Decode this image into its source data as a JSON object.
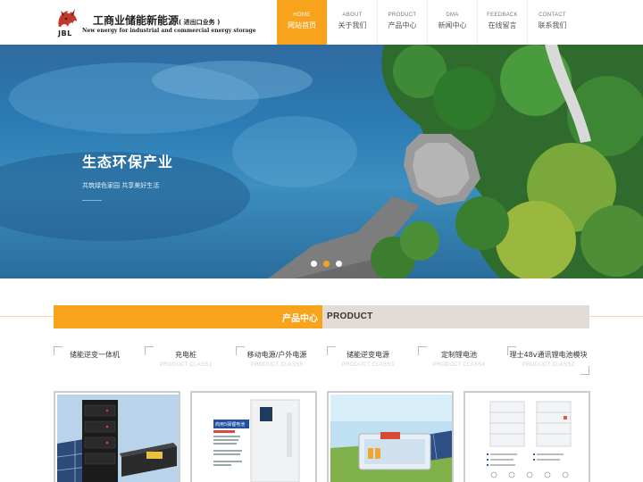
{
  "header": {
    "logo_mark": "JBL",
    "logo_title": "工商业储能新能源",
    "logo_title_note": "( 进出口业务 )",
    "logo_subtitle": "New energy for industrial and commercial energy storage"
  },
  "nav": [
    {
      "en": "HOME",
      "cn": "网站首页",
      "active": true
    },
    {
      "en": "ABOUT",
      "cn": "关于我们",
      "active": false
    },
    {
      "en": "PRODUCT",
      "cn": "产品中心",
      "active": false
    },
    {
      "en": "DMA",
      "cn": "新闻中心",
      "active": false
    },
    {
      "en": "FEEDBACK",
      "cn": "在线留言",
      "active": false
    },
    {
      "en": "CONTACT",
      "cn": "联系我们",
      "active": false
    }
  ],
  "banner": {
    "title": "生态环保产业",
    "subtitle": "共筑绿色家园 共享美好生活",
    "slide_count": 3,
    "active_slide": 2
  },
  "products": {
    "title_cn": "产品中心",
    "title_en": "PRODUCT",
    "categories": [
      {
        "name": "储能逆变一体机",
        "en": ""
      },
      {
        "name": "充电桩",
        "en": "PRODUCT CLASS1"
      },
      {
        "name": "移动电源/户外电源",
        "en": "PRODUCT CLASS5"
      },
      {
        "name": "储能逆变电源",
        "en": "PRODUCT CLASS3"
      },
      {
        "name": "定制锂电池",
        "en": "PRODUCT CLASS4"
      },
      {
        "name": "理士48v通讯锂电池模块",
        "en": "PRODUCT CLASS2"
      }
    ],
    "cards": [
      {
        "label": "rack-battery-solar"
      },
      {
        "label": "cabinet-battery",
        "badge": "商用5驿锂电池"
      },
      {
        "label": "battery-pack-solar"
      },
      {
        "label": "stacked-battery-modules"
      }
    ]
  },
  "colors": {
    "accent": "#f7a31c",
    "product_en_bar": "#e2dbd6"
  }
}
